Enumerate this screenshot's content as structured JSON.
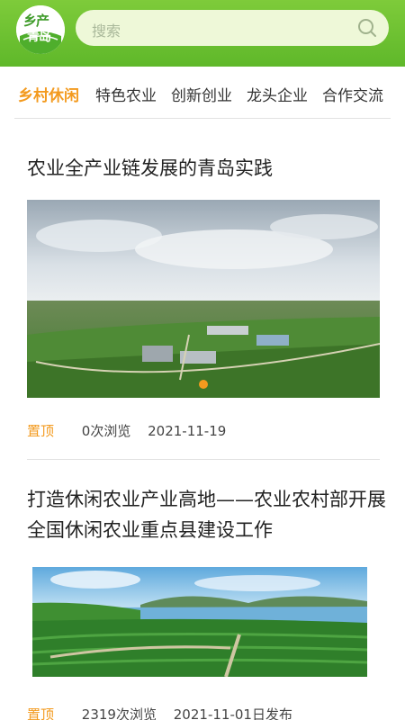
{
  "app": {
    "logo_line1": "乡产",
    "logo_line2": "青岛"
  },
  "search": {
    "placeholder": "搜索"
  },
  "tabs": [
    {
      "label": "乡村休闲",
      "active": true
    },
    {
      "label": "特色农业",
      "active": false
    },
    {
      "label": "创新创业",
      "active": false
    },
    {
      "label": "龙头企业",
      "active": false
    },
    {
      "label": "合作交流",
      "active": false
    }
  ],
  "articles": [
    {
      "title": "农业全产业链发展的青岛实践",
      "pin": "置顶",
      "views": "0次浏览",
      "date": "2021-11-19"
    },
    {
      "title": "打造休闲农业产业高地——农业农村部开展全国休闲农业重点县建设工作",
      "pin": "置顶",
      "views": "2319次浏览",
      "date": "2021-11-01日发布"
    }
  ],
  "colors": {
    "header_green": "#6cc033",
    "accent_orange": "#f39a1e"
  }
}
